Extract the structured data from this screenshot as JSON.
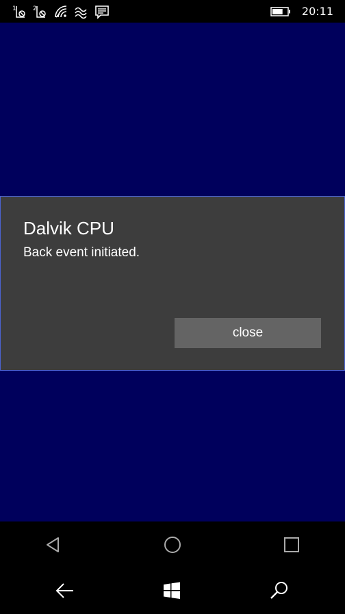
{
  "status_bar": {
    "left_icons": [
      "sim1-no-signal-icon",
      "sim2-no-signal-icon",
      "wifi-icon",
      "data-sense-icon",
      "message-icon"
    ],
    "sim1_label": "1",
    "sim2_label": "2",
    "battery_level": 0.7,
    "time": "20:11"
  },
  "colors": {
    "app_background": "#00005c",
    "dialog_background": "#3d3d3d",
    "dialog_border": "#4c63d2",
    "button_background": "#646464"
  },
  "dialog": {
    "title": "Dalvik CPU",
    "message": "Back event initiated.",
    "close_label": "close"
  },
  "nav": {
    "top_row": [
      "android-back-icon",
      "android-home-icon",
      "android-recents-icon"
    ],
    "bottom_row": [
      "back-arrow-icon",
      "windows-start-icon",
      "search-icon"
    ]
  }
}
